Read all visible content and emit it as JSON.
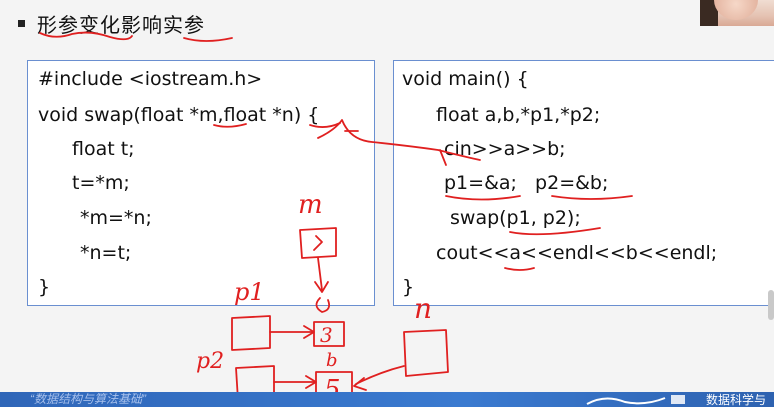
{
  "slide": {
    "title": "形参变化影响实参"
  },
  "left_code": {
    "lines": [
      "#include <iostream.h>",
      "void swap(float *m,float *n) {",
      "float t;",
      "t=*m;",
      "*m=*n;",
      "*n=t;",
      "}"
    ]
  },
  "right_code": {
    "lines": [
      "void main() {",
      "float a,b,*p1,*p2;",
      "cin>>a>>b;",
      "p1=&a;   p2=&b;",
      "swap(p1, p2);",
      "cout<<a<<endl<<b<<endl;",
      "}"
    ]
  },
  "annotations": {
    "m": "m",
    "n": "n",
    "p1": "p1",
    "p2": "p2",
    "a": "a",
    "b": "b",
    "val3": "3",
    "val5": "5"
  },
  "footer": {
    "left_text": "“数据结构与算法基础”",
    "brand": "数据科学与"
  },
  "colors": {
    "ink": "#e02020",
    "box_border": "#6a8fd0",
    "footer_bar": "#2f66b8"
  }
}
